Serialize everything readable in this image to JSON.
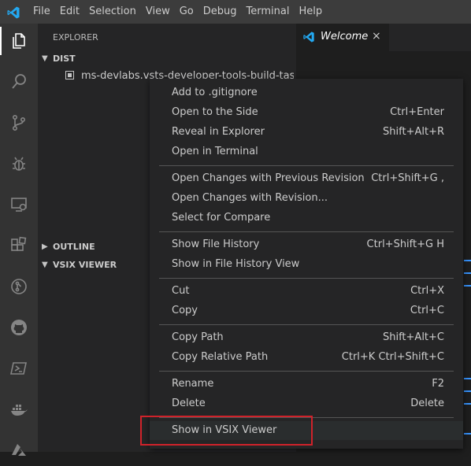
{
  "menubar": {
    "items": [
      "File",
      "Edit",
      "Selection",
      "View",
      "Go",
      "Debug",
      "Terminal",
      "Help"
    ]
  },
  "activity_bar": {
    "icons": [
      "files-icon",
      "search-icon",
      "source-control-icon",
      "debug-icon",
      "remote-explorer-icon",
      "extensions-icon",
      "gitlens-icon",
      "github-icon",
      "powershell-icon",
      "docker-icon",
      "azure-icon"
    ]
  },
  "sidebar": {
    "title": "EXPLORER",
    "dist_label": "DIST",
    "file_name": "ms-devlabs.vsts-developer-tools-build-tasks-",
    "outline_label": "OUTLINE",
    "vsix_label": "VSIX VIEWER"
  },
  "editor": {
    "tab_label": "Welcome",
    "tab_close": "×"
  },
  "context_menu": {
    "groups": [
      [
        {
          "label": "Add to .gitignore",
          "shortcut": ""
        },
        {
          "label": "Open to the Side",
          "shortcut": "Ctrl+Enter"
        },
        {
          "label": "Reveal in Explorer",
          "shortcut": "Shift+Alt+R"
        },
        {
          "label": "Open in Terminal",
          "shortcut": ""
        }
      ],
      [
        {
          "label": "Open Changes with Previous Revision",
          "shortcut": "Ctrl+Shift+G ,"
        },
        {
          "label": "Open Changes with Revision...",
          "shortcut": ""
        },
        {
          "label": "Select for Compare",
          "shortcut": ""
        }
      ],
      [
        {
          "label": "Show File History",
          "shortcut": "Ctrl+Shift+G H"
        },
        {
          "label": "Show in File History View",
          "shortcut": ""
        }
      ],
      [
        {
          "label": "Cut",
          "shortcut": "Ctrl+X"
        },
        {
          "label": "Copy",
          "shortcut": "Ctrl+C"
        }
      ],
      [
        {
          "label": "Copy Path",
          "shortcut": "Shift+Alt+C"
        },
        {
          "label": "Copy Relative Path",
          "shortcut": "Ctrl+K Ctrl+Shift+C"
        }
      ],
      [
        {
          "label": "Rename",
          "shortcut": "F2"
        },
        {
          "label": "Delete",
          "shortcut": "Delete"
        }
      ],
      [
        {
          "label": "Show in VSIX Viewer",
          "shortcut": ""
        }
      ]
    ]
  },
  "colors": {
    "accent": "#007acc",
    "highlight_border": "#d0222a",
    "link": "#3794ff"
  }
}
